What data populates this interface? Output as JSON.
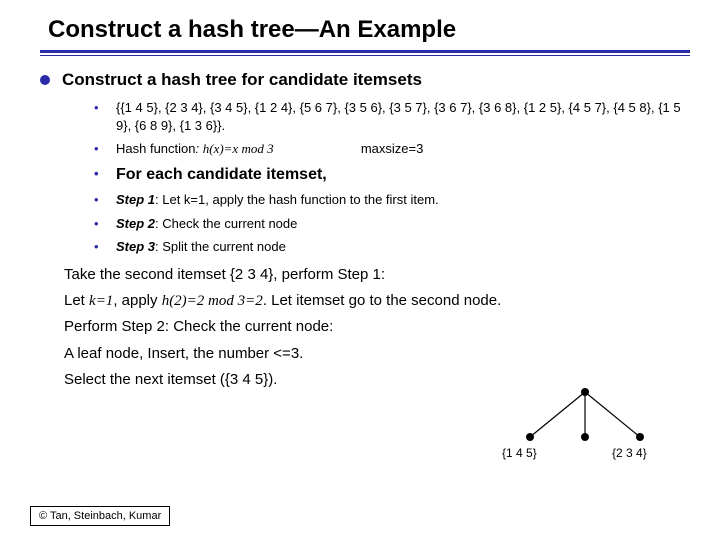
{
  "title": "Construct a hash tree—An Example",
  "lead": "Construct a hash tree for candidate itemsets",
  "bullets": {
    "itemsets": "{{1 4 5}, {2 3 4}, {3 4 5}, {1 2 4}, {5 6 7}, {3 5 6}, {3 5 7}, {3 6 7}, {3 6 8}, {1 2 5}, {4 5 7}, {4 5 8}, {1 5 9}, {6 8 9}, {1 3 6}}.",
    "hash_prefix": "Hash function",
    "hash_colon": ": ",
    "hash_formula": "h(x)=x mod 3",
    "maxsize": "maxsize=3",
    "for_each": "For each candidate itemset,",
    "step1_prefix": "Step 1",
    "step1_rest": ": Let k=1, apply the hash function to the first item.",
    "step2_prefix": "Step 2",
    "step2_rest": ": Check the current node",
    "step3_prefix": "Step 3",
    "step3_rest": ": Split the current node"
  },
  "body": {
    "l1": "Take the second itemset {2 3 4}, perform Step 1:",
    "l2_a": "Let ",
    "l2_k": "k=1",
    "l2_b": ", apply ",
    "l2_h": "h(2)=2 mod 3=2",
    "l2_c": ". Let itemset go to the second node.",
    "l3": "Perform  Step 2: Check the current node:",
    "l4": "A leaf node, Insert, the number <=3.",
    "l5": "Select the next itemset ({3 4 5})."
  },
  "tree": {
    "left_label": "{1 4 5}",
    "right_label": "{2 3 4}"
  },
  "footer": "© Tan, Steinbach, Kumar"
}
